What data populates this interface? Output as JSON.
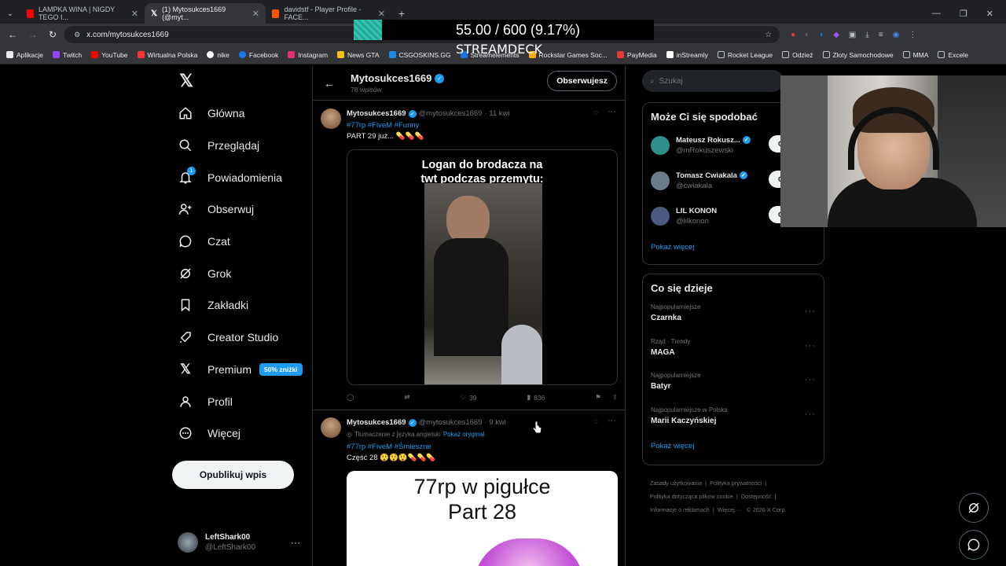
{
  "browser": {
    "tabs": [
      {
        "label": "LAMPKA WINA | NIGDY TEGO I...",
        "color": "#ff0000"
      },
      {
        "label": "(1) Mytosukces1669 (@myt...",
        "color": "#ffffff"
      },
      {
        "label": "davidstf - Player Profile - FACE...",
        "color": "#ff5500"
      }
    ],
    "new_tab": "+",
    "url": "x.com/mytosukces1669",
    "bookmarks": [
      {
        "label": "Aplikacje",
        "color": "#e8eaed"
      },
      {
        "label": "Twitch",
        "color": "#9146ff"
      },
      {
        "label": "YouTube",
        "color": "#ff0000"
      },
      {
        "label": "Wirtualna Polska",
        "color": "#ff3333"
      },
      {
        "label": "nike",
        "color": "#ffffff"
      },
      {
        "label": "Facebook",
        "color": "#1877f2"
      },
      {
        "label": "Instagram",
        "color": "#e1306c"
      },
      {
        "label": "News GTA",
        "color": "#f4c20d"
      },
      {
        "label": "CSGOSKINS.GG",
        "color": "#1e88e5"
      },
      {
        "label": "Streamelements",
        "color": "#1a73e8"
      },
      {
        "label": "Rockstar Games Soc...",
        "color": "#ffab00"
      },
      {
        "label": "PayMedia",
        "color": "#e53935"
      },
      {
        "label": "inStreamly",
        "color": "#ffffff"
      },
      {
        "label": "Rocket League",
        "color": "#bdc1c6"
      },
      {
        "label": "Odzież",
        "color": "#bdc1c6"
      },
      {
        "label": "Złoty Samochodowe",
        "color": "#bdc1c6"
      },
      {
        "label": "MMA",
        "color": "#bdc1c6"
      },
      {
        "label": "Excele",
        "color": "#bdc1c6"
      }
    ]
  },
  "overlay": {
    "counter": "55.00 / 600 (9.17%)",
    "streamdeck": "STREAMDECK"
  },
  "nav": {
    "items": [
      {
        "label": "Główna",
        "icon": "home-icon"
      },
      {
        "label": "Przeglądaj",
        "icon": "search-icon"
      },
      {
        "label": "Powiadomienia",
        "icon": "bell-icon",
        "badge": "1"
      },
      {
        "label": "Obserwuj",
        "icon": "add-person-icon"
      },
      {
        "label": "Czat",
        "icon": "chat-icon"
      },
      {
        "label": "Grok",
        "icon": "grok-icon"
      },
      {
        "label": "Zakładki",
        "icon": "bookmark-icon"
      },
      {
        "label": "Creator Studio",
        "icon": "rocket-icon"
      },
      {
        "label": "Premium",
        "icon": "x-logo-icon",
        "badge_text": "50% zniżki"
      },
      {
        "label": "Profil",
        "icon": "person-icon"
      },
      {
        "label": "Więcej",
        "icon": "more-circle-icon"
      }
    ],
    "post_button": "Opublikuj wpis",
    "user": {
      "name": "LeftShark00",
      "handle": "@LeftShark00"
    }
  },
  "profile": {
    "name": "Mytosukces1669",
    "posts_count": "78 wpisów",
    "follow_label": "Obserwujesz"
  },
  "tweets": [
    {
      "name": "Mytosukces1669",
      "handle": "@mytosukces1669",
      "time": "· 11 kwi",
      "hashtags": "#77rp #FiveM #Funny",
      "text": "PART 29 już... 💊💊💊",
      "media_caption_line1": "Logan do brodacza na",
      "media_caption_line2": "twt podczas przemytu:",
      "likes": "39",
      "views": "836"
    },
    {
      "name": "Mytosukces1669",
      "handle": "@mytosukces1669",
      "time": "· 9 kwi",
      "translated_note": "Tłumaczenie z języka angielski",
      "show_original": "Pokaż oryginał",
      "hashtags": "#77rp #FiveM #Śmieszne",
      "text": "Część 28 😲😲😲💊💊💊",
      "media_caption_line1": "77rp w pigułce",
      "media_caption_line2": "Part 28"
    }
  ],
  "right": {
    "search_placeholder": "Szukaj",
    "who_to_follow_title": "Może Ci się spodobać",
    "suggestions": [
      {
        "name": "Mateusz Rokusz...",
        "handle": "@mRokuszewski",
        "follow": "Ob",
        "color": "#2f8f8a"
      },
      {
        "name": "Tomasz Cwiakala",
        "handle": "@cwiakala",
        "follow": "Ob",
        "color": "#6d7b8a"
      },
      {
        "name": "LIL KONON",
        "handle": "@lilkonon",
        "follow": "Ob",
        "color": "#4a5a80"
      }
    ],
    "show_more": "Pokaż więcej",
    "trends_title": "Co się dzieje",
    "trends": [
      {
        "category": "Najpopularniejsze",
        "title": "Czarnka"
      },
      {
        "category": "Rząd · Trendy",
        "title": "MAGA"
      },
      {
        "category": "Najpopularniejsze",
        "title": "Batyr"
      },
      {
        "category": "Najpopularniejsze w Polska",
        "title": "Marii Kaczyńskiej"
      }
    ],
    "trends_show_more": "Pokaż więcej",
    "footer": {
      "l1": "Zasady użytkowania",
      "l2": "Polityka prywatności",
      "l3": "Polityka dotycząca plików cookie",
      "l4": "Dostępność",
      "l5": "Informacje o reklamach",
      "l6": "Więcej ···",
      "l7": "© 2026 X Corp."
    }
  },
  "colors": {
    "accent": "#1d9bf0",
    "background": "#000000",
    "border": "#2f3336"
  }
}
